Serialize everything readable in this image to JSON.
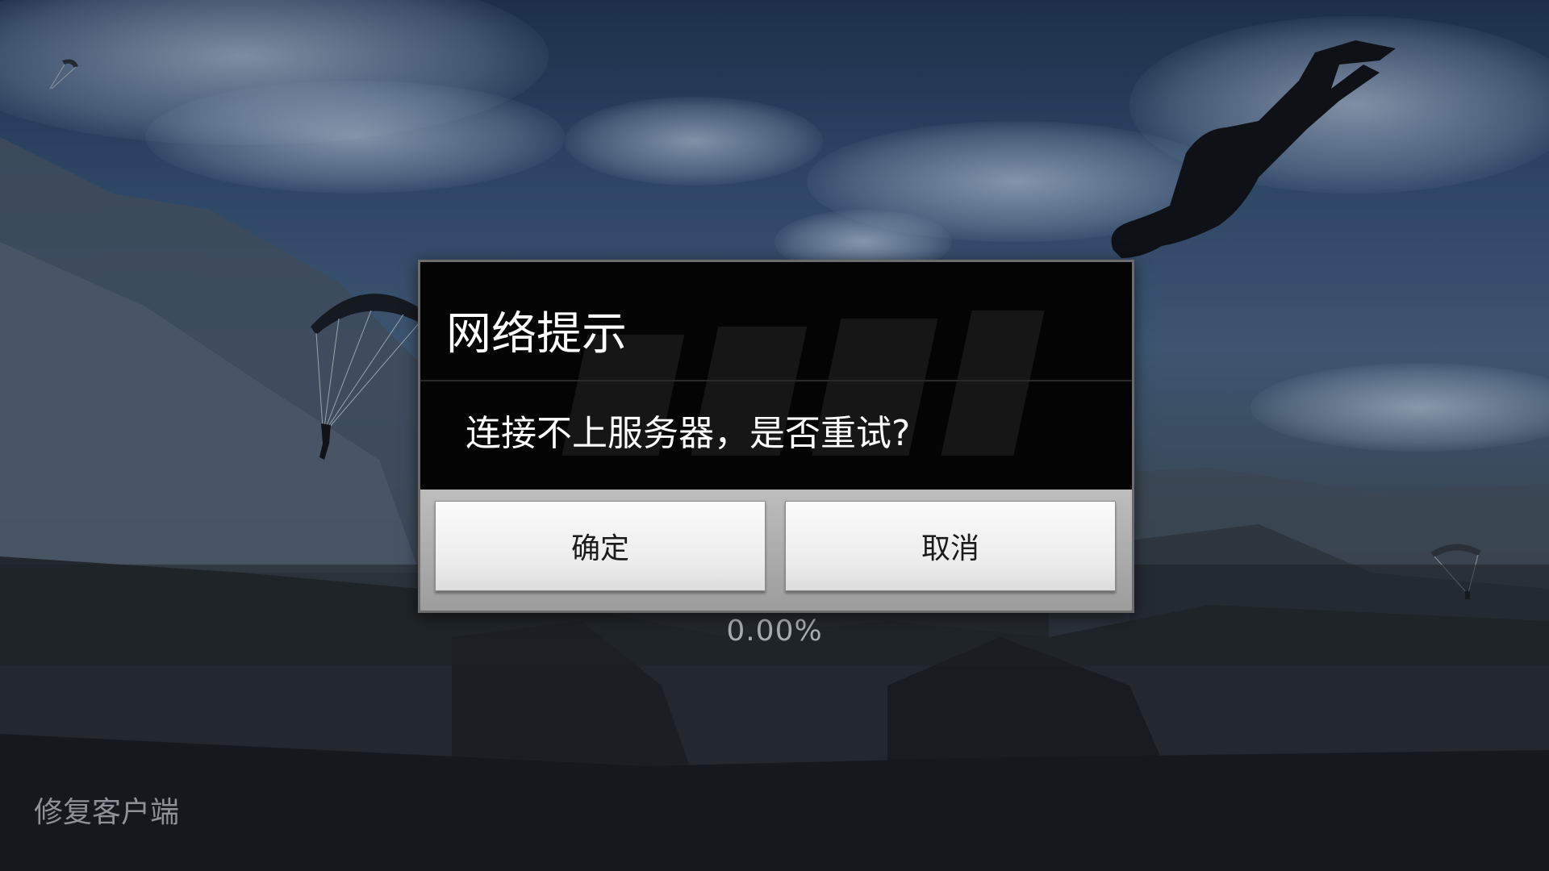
{
  "dialog": {
    "title": "网络提示",
    "message": "连接不上服务器，是否重试?",
    "confirm_label": "确定",
    "cancel_label": "取消"
  },
  "progress": {
    "text": "0.00%",
    "value": 0
  },
  "footer": {
    "repair_label": "修复客户端"
  },
  "colors": {
    "dialog_background": "#040404",
    "dialog_footer": "#a8a8a8",
    "button_face": "#f2f2f2",
    "progress_text": "#a9adb3"
  }
}
